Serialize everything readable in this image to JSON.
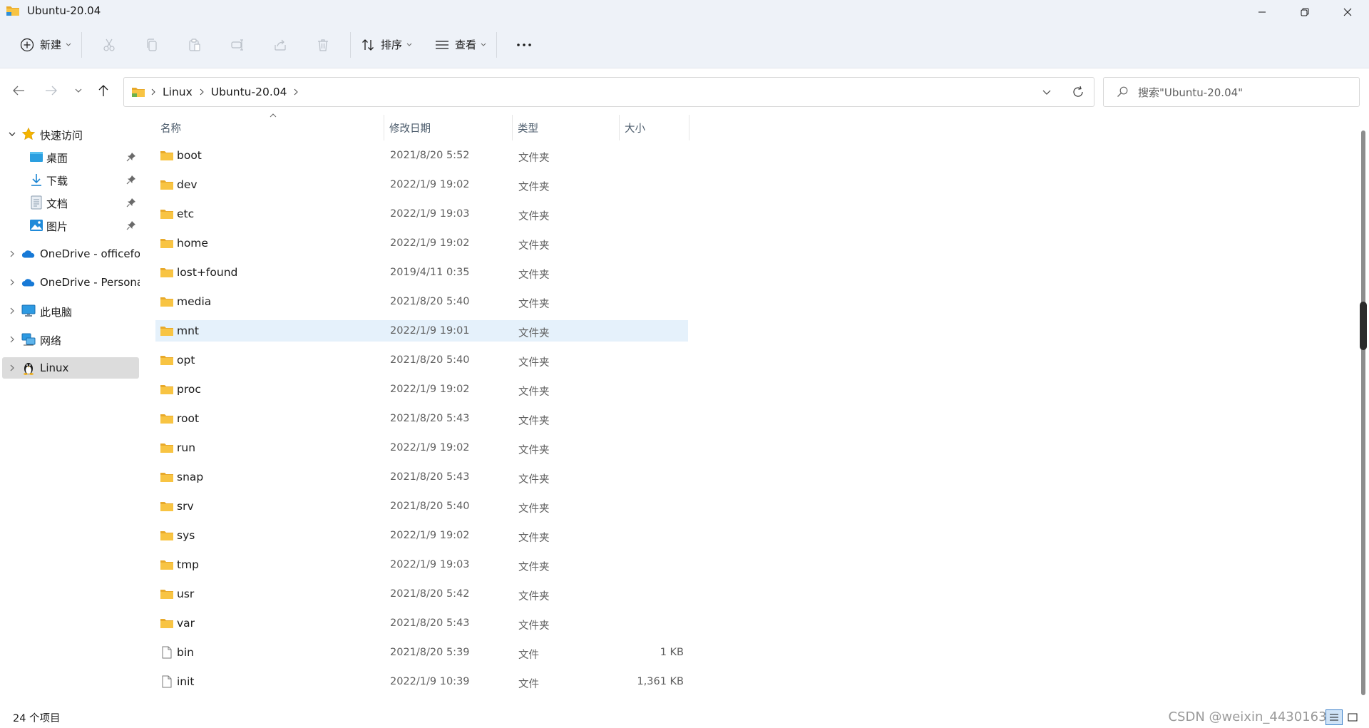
{
  "window": {
    "title": "Ubuntu-20.04",
    "folder_color": "#f8c443",
    "accent": "#0067c0"
  },
  "toolbar": {
    "new_label": "新建",
    "sort_label": "排序",
    "view_label": "查看"
  },
  "address": {
    "crumbs": [
      "Linux",
      "Ubuntu-20.04"
    ],
    "search_placeholder": "搜索\"Ubuntu-20.04\""
  },
  "sidebar": {
    "quick_access": "快速访问",
    "pinned": [
      {
        "label": "桌面",
        "icon": "desktop-icon"
      },
      {
        "label": "下载",
        "icon": "download-icon"
      },
      {
        "label": "文档",
        "icon": "document-icon"
      },
      {
        "label": "图片",
        "icon": "pictures-icon"
      }
    ],
    "roots": [
      {
        "label": "OneDrive - officefo",
        "icon": "onedrive-icon"
      },
      {
        "label": "OneDrive - Persona",
        "icon": "onedrive-icon"
      },
      {
        "label": "此电脑",
        "icon": "this-pc-icon"
      },
      {
        "label": "网络",
        "icon": "network-icon"
      },
      {
        "label": "Linux",
        "icon": "linux-penguin-icon",
        "selected": true
      }
    ]
  },
  "columns": {
    "name": "名称",
    "modified": "修改日期",
    "type": "类型",
    "size": "大小"
  },
  "files": [
    {
      "name": "boot",
      "date": "2021/8/20 5:52",
      "type": "文件夹",
      "size": "",
      "kind": "folder"
    },
    {
      "name": "dev",
      "date": "2022/1/9 19:02",
      "type": "文件夹",
      "size": "",
      "kind": "folder"
    },
    {
      "name": "etc",
      "date": "2022/1/9 19:03",
      "type": "文件夹",
      "size": "",
      "kind": "folder"
    },
    {
      "name": "home",
      "date": "2022/1/9 19:02",
      "type": "文件夹",
      "size": "",
      "kind": "folder"
    },
    {
      "name": "lost+found",
      "date": "2019/4/11 0:35",
      "type": "文件夹",
      "size": "",
      "kind": "folder"
    },
    {
      "name": "media",
      "date": "2021/8/20 5:40",
      "type": "文件夹",
      "size": "",
      "kind": "folder"
    },
    {
      "name": "mnt",
      "date": "2022/1/9 19:01",
      "type": "文件夹",
      "size": "",
      "kind": "folder",
      "selected": true
    },
    {
      "name": "opt",
      "date": "2021/8/20 5:40",
      "type": "文件夹",
      "size": "",
      "kind": "folder"
    },
    {
      "name": "proc",
      "date": "2022/1/9 19:02",
      "type": "文件夹",
      "size": "",
      "kind": "folder"
    },
    {
      "name": "root",
      "date": "2021/8/20 5:43",
      "type": "文件夹",
      "size": "",
      "kind": "folder"
    },
    {
      "name": "run",
      "date": "2022/1/9 19:02",
      "type": "文件夹",
      "size": "",
      "kind": "folder"
    },
    {
      "name": "snap",
      "date": "2021/8/20 5:43",
      "type": "文件夹",
      "size": "",
      "kind": "folder"
    },
    {
      "name": "srv",
      "date": "2021/8/20 5:40",
      "type": "文件夹",
      "size": "",
      "kind": "folder"
    },
    {
      "name": "sys",
      "date": "2022/1/9 19:02",
      "type": "文件夹",
      "size": "",
      "kind": "folder"
    },
    {
      "name": "tmp",
      "date": "2022/1/9 19:03",
      "type": "文件夹",
      "size": "",
      "kind": "folder"
    },
    {
      "name": "usr",
      "date": "2021/8/20 5:42",
      "type": "文件夹",
      "size": "",
      "kind": "folder"
    },
    {
      "name": "var",
      "date": "2021/8/20 5:43",
      "type": "文件夹",
      "size": "",
      "kind": "folder"
    },
    {
      "name": "bin",
      "date": "2021/8/20 5:39",
      "type": "文件",
      "size": "1 KB",
      "kind": "file"
    },
    {
      "name": "init",
      "date": "2022/1/9 10:39",
      "type": "文件",
      "size": "1,361 KB",
      "kind": "file"
    }
  ],
  "status": {
    "item_count": "24 个项目",
    "watermark": "CSDN @weixin_44301630"
  }
}
